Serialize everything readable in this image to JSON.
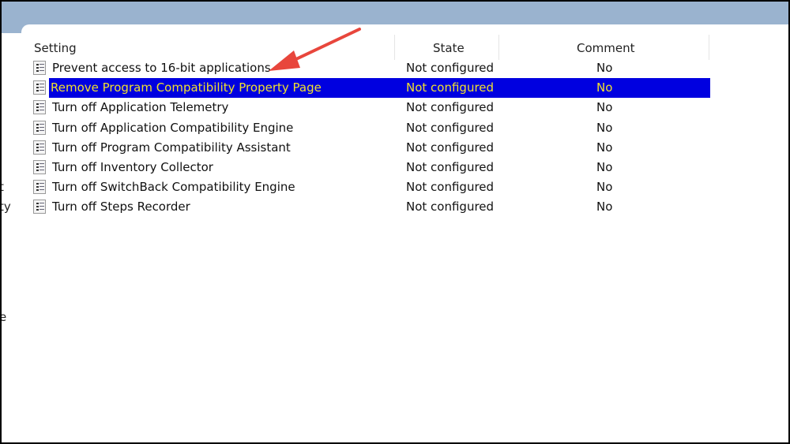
{
  "left_fragments": [
    "t",
    "ty",
    "e"
  ],
  "columns": {
    "setting": "Setting",
    "state": "State",
    "comment": "Comment"
  },
  "rows": [
    {
      "name": "Prevent access to 16-bit applications",
      "state": "Not configured",
      "comment": "No"
    },
    {
      "name": "Remove Program Compatibility Property Page",
      "state": "Not configured",
      "comment": "No",
      "selected": true
    },
    {
      "name": "Turn off Application Telemetry",
      "state": "Not configured",
      "comment": "No"
    },
    {
      "name": "Turn off Application Compatibility Engine",
      "state": "Not configured",
      "comment": "No"
    },
    {
      "name": "Turn off Program Compatibility Assistant",
      "state": "Not configured",
      "comment": "No"
    },
    {
      "name": "Turn off Inventory Collector",
      "state": "Not configured",
      "comment": "No"
    },
    {
      "name": "Turn off SwitchBack Compatibility Engine",
      "state": "Not configured",
      "comment": "No"
    },
    {
      "name": "Turn off Steps Recorder",
      "state": "Not configured",
      "comment": "No"
    }
  ],
  "colors": {
    "selection": "#0000e0",
    "selection_text": "#f0e030",
    "arrow": "#e8463c",
    "titlebar": "#9ab3cf"
  }
}
